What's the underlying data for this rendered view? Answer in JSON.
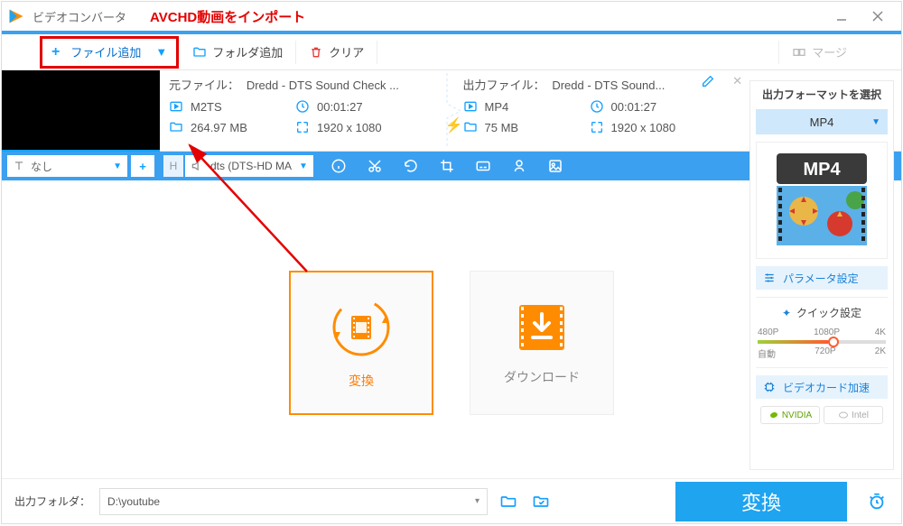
{
  "title": {
    "app": "ビデオコンバータ",
    "annotation": "AVCHD動画をインポート"
  },
  "toolbar": {
    "add_file": "ファイル追加",
    "add_folder": "フォルダ追加",
    "clear": "クリア",
    "merge": "マージ"
  },
  "file": {
    "source": {
      "title_label": "元ファイル：",
      "title": "Dredd - DTS Sound Check ...",
      "format": "M2TS",
      "duration": "00:01:27",
      "size": "264.97 MB",
      "resolution": "1920 x 1080"
    },
    "output": {
      "title_label": "出力ファイル：",
      "title": "Dredd - DTS Sound...",
      "format": "MP4",
      "duration": "00:01:27",
      "size": "75 MB",
      "resolution": "1920 x 1080"
    }
  },
  "editbar": {
    "subtitle_label": "なし",
    "audio_track": "dts (DTS-HD MA"
  },
  "center": {
    "convert": "変換",
    "download": "ダウンロード"
  },
  "right": {
    "title": "出力フォーマットを選択",
    "format": "MP4",
    "thumb_label": "MP4",
    "params": "パラメータ設定",
    "quick": "クイック設定",
    "slider": {
      "p1": "480P",
      "p2": "1080P",
      "p3": "4K",
      "a": "自動",
      "b": "720P",
      "c": "2K"
    },
    "gpu": "ビデオカード加速",
    "vendor_nv": "NVIDIA",
    "vendor_intel": "Intel"
  },
  "bottom": {
    "label": "出力フォルダ：",
    "path": "D:\\youtube",
    "convert": "変換"
  }
}
